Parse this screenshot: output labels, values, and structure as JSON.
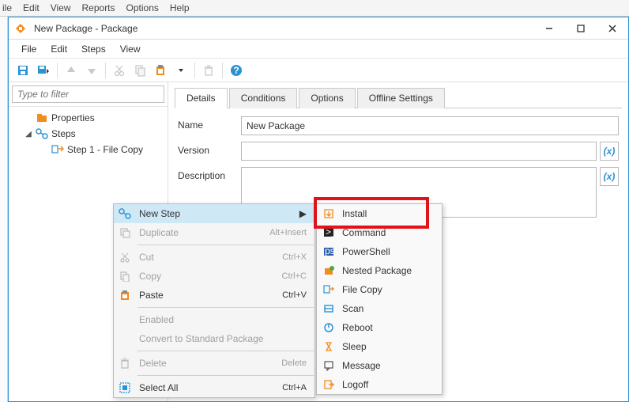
{
  "outer_menu": [
    "ile",
    "Edit",
    "View",
    "Reports",
    "Options",
    "Help"
  ],
  "window": {
    "title": "New Package - Package"
  },
  "menubar": [
    "File",
    "Edit",
    "Steps",
    "View"
  ],
  "sidebar": {
    "filter_placeholder": "Type to filter",
    "tree": {
      "properties": "Properties",
      "steps": "Steps",
      "step1": "Step 1 - File Copy"
    }
  },
  "tabs": [
    "Details",
    "Conditions",
    "Options",
    "Offline Settings"
  ],
  "form": {
    "name_label": "Name",
    "name_value": "New Package",
    "version_label": "Version",
    "version_value": "",
    "description_label": "Description",
    "description_value": "",
    "var_btn": "(x)"
  },
  "context_menu": {
    "items": [
      {
        "label": "New Step",
        "shortcut": "",
        "enabled": true,
        "hover": true,
        "arrow": true
      },
      {
        "label": "Duplicate",
        "shortcut": "Alt+Insert",
        "enabled": false
      },
      {
        "sep": true
      },
      {
        "label": "Cut",
        "shortcut": "Ctrl+X",
        "enabled": false
      },
      {
        "label": "Copy",
        "shortcut": "Ctrl+C",
        "enabled": false
      },
      {
        "label": "Paste",
        "shortcut": "Ctrl+V",
        "enabled": true
      },
      {
        "sep": true
      },
      {
        "label": "Enabled",
        "shortcut": "",
        "enabled": false
      },
      {
        "label": "Convert to Standard Package",
        "shortcut": "",
        "enabled": false
      },
      {
        "sep": true
      },
      {
        "label": "Delete",
        "shortcut": "Delete",
        "enabled": false
      },
      {
        "sep": true
      },
      {
        "label": "Select All",
        "shortcut": "Ctrl+A",
        "enabled": true
      }
    ]
  },
  "submenu": {
    "items": [
      "Install",
      "Command",
      "PowerShell",
      "Nested Package",
      "File Copy",
      "Scan",
      "Reboot",
      "Sleep",
      "Message",
      "Logoff"
    ]
  },
  "submenu_icons": [
    "install-icon",
    "command-icon",
    "powershell-icon",
    "nested-package-icon",
    "file-copy-icon",
    "scan-icon",
    "reboot-icon",
    "sleep-icon",
    "message-icon",
    "logoff-icon"
  ],
  "icon_colors": {
    "accent": "#2a93d4",
    "orange": "#f28c1f",
    "red": "#e1121a",
    "green": "#4aa94a"
  }
}
